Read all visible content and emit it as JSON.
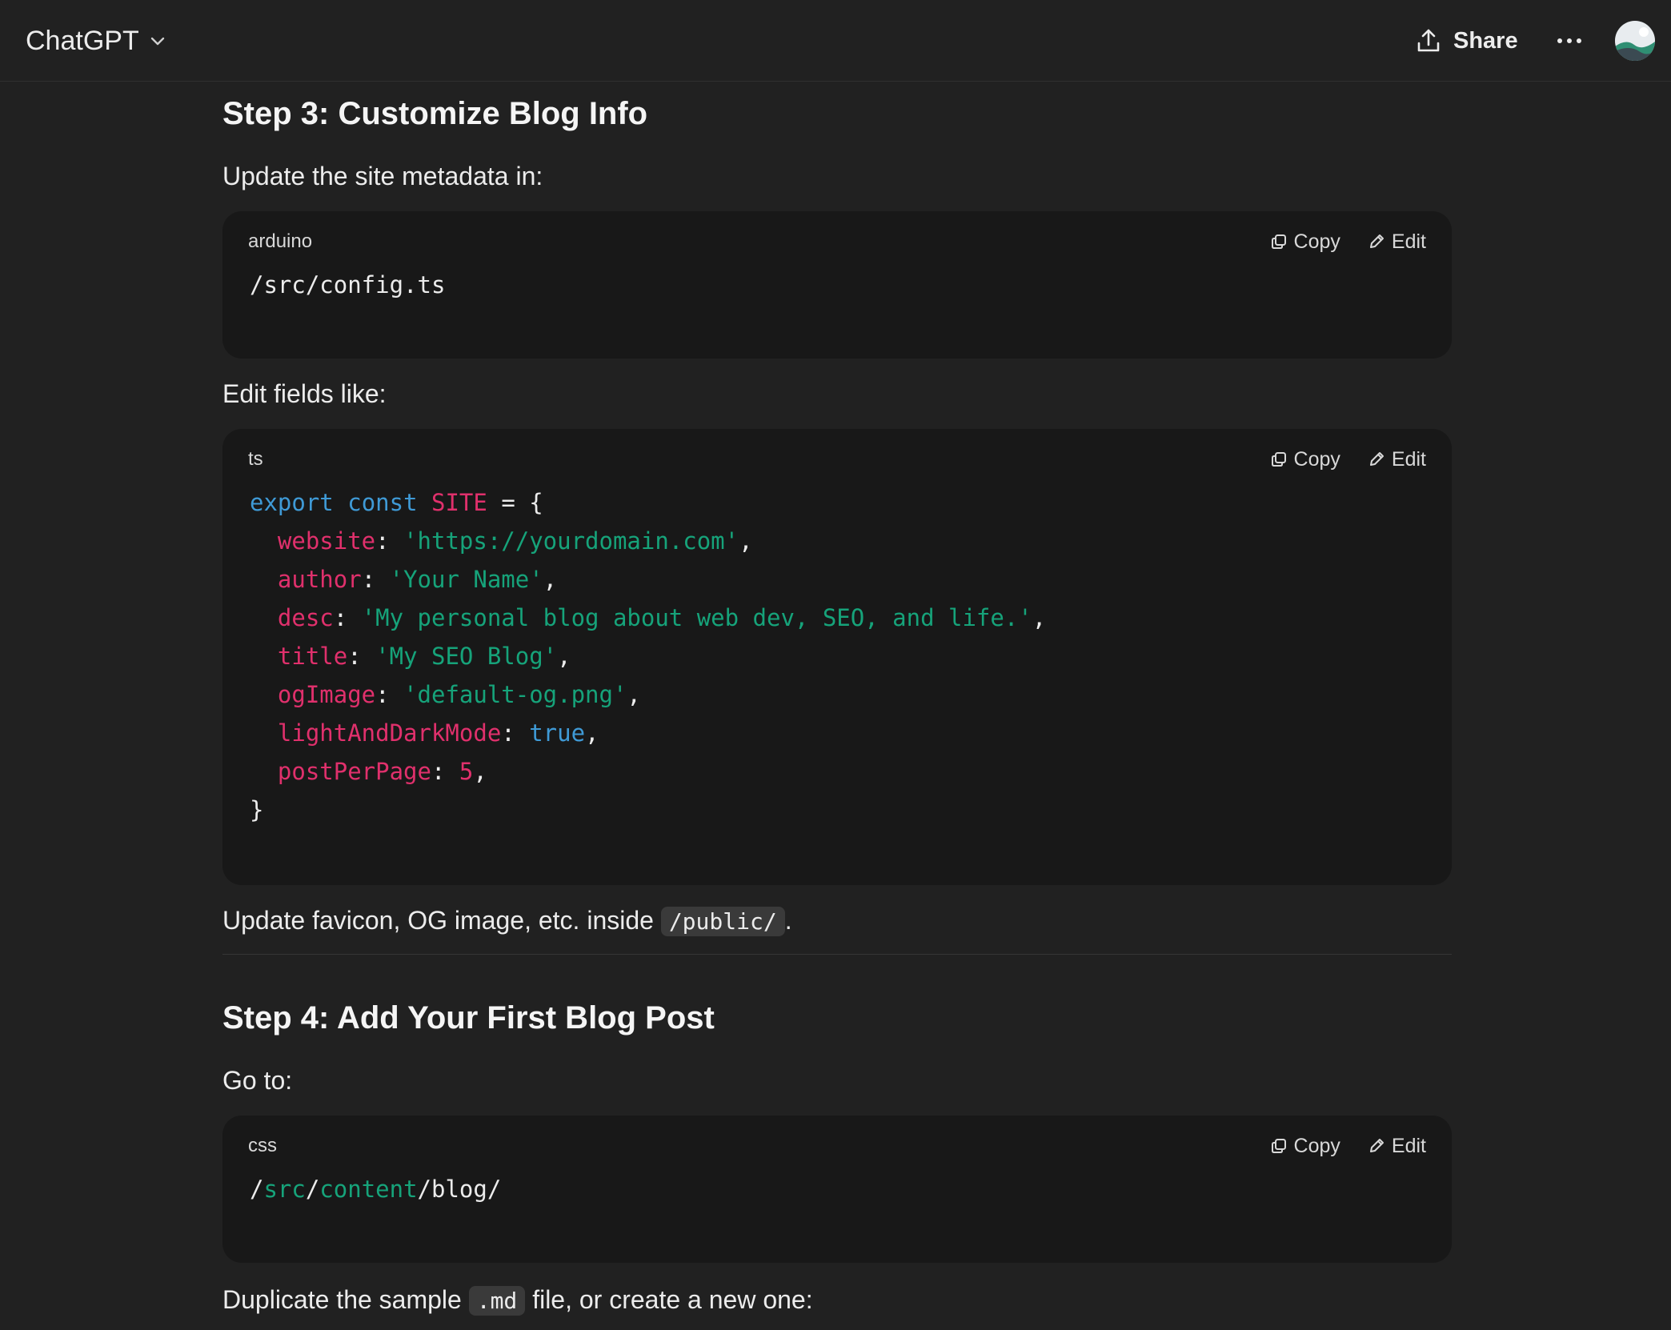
{
  "header": {
    "model_title": "ChatGPT",
    "share_label": "Share"
  },
  "step3": {
    "heading": "Step 3: Customize Blog Info",
    "intro": "Update the site metadata in:",
    "block1": {
      "lang": "arduino",
      "copy": "Copy",
      "edit": "Edit",
      "code": "/src/config.ts"
    },
    "fields_intro": "Edit fields like:",
    "block2": {
      "lang": "ts",
      "copy": "Copy",
      "edit": "Edit",
      "lines": {
        "l1_kw1": "export",
        "l1_kw2": "const",
        "l1_name": "SITE",
        "l1_rest": " = {",
        "website_key": "website",
        "website_val": "'https://yourdomain.com'",
        "author_key": "author",
        "author_val": "'Your Name'",
        "desc_key": "desc",
        "desc_val": "'My personal blog about web dev, SEO, and life.'",
        "title_key": "title",
        "title_val": "'My SEO Blog'",
        "og_key": "ogImage",
        "og_val": "'default-og.png'",
        "mode_key": "lightAndDarkMode",
        "mode_val": "true",
        "ppp_key": "postPerPage",
        "ppp_val": "5",
        "close": "}"
      }
    },
    "favicon_text": "Update favicon, OG image, etc. inside ",
    "favicon_code": "/public/",
    "favicon_end": "."
  },
  "step4": {
    "heading": "Step 4: Add Your First Blog Post",
    "intro": "Go to:",
    "block3": {
      "lang": "css",
      "copy": "Copy",
      "edit": "Edit",
      "seg1": "/",
      "seg2": "src",
      "seg3": "/",
      "seg4": "content",
      "seg5": "/blog/"
    },
    "dup_text1": "Duplicate the sample ",
    "dup_code": ".md",
    "dup_text2": " file, or create a new one:"
  }
}
